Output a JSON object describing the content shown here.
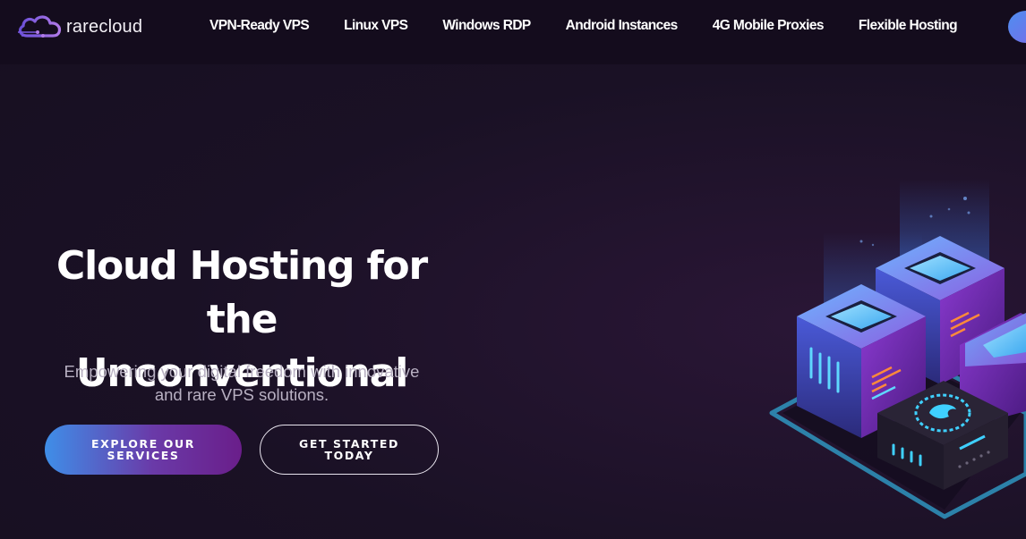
{
  "header": {
    "brand": "rarecloud",
    "nav": [
      "VPN-Ready VPS",
      "Linux VPS",
      "Windows RDP",
      "Android Instances",
      "4G Mobile Proxies",
      "Flexible Hosting"
    ]
  },
  "hero": {
    "title_line1": "Cloud Hosting for",
    "title_line2": "the Unconventional",
    "subtitle_line1": "Empowering your digital freedom with innovative",
    "subtitle_line2": "and rare VPS solutions.",
    "primary_button": "EXPLORE OUR SERVICES",
    "secondary_button": "GET STARTED TODAY"
  },
  "colors": {
    "background": "#1a1125",
    "header": "#140c1d",
    "accent_blue": "#3f8ee8",
    "accent_purple": "#6a1e8a"
  },
  "icons": {
    "logo": "cloud-logo-icon",
    "illustration": "server-cubes-illustration"
  }
}
